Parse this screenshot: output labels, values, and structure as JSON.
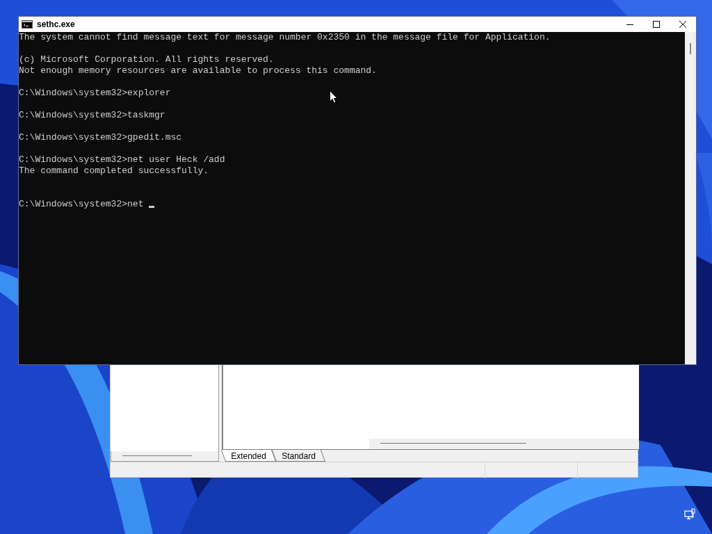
{
  "console": {
    "title": "sethc.exe",
    "lines": [
      {
        "kind": "output",
        "text": "The system cannot find message text for message number 0x2350 in the message file for Application."
      },
      {
        "kind": "blank"
      },
      {
        "kind": "output",
        "text": "(c) Microsoft Corporation. All rights reserved."
      },
      {
        "kind": "output",
        "text": "Not enough memory resources are available to process this command."
      },
      {
        "kind": "blank"
      },
      {
        "kind": "output",
        "text": "C:\\Windows\\system32>explorer"
      },
      {
        "kind": "blank"
      },
      {
        "kind": "output",
        "text": "C:\\Windows\\system32>taskmgr"
      },
      {
        "kind": "blank"
      },
      {
        "kind": "output",
        "text": "C:\\Windows\\system32>gpedit.msc"
      },
      {
        "kind": "blank"
      },
      {
        "kind": "output",
        "text": "C:\\Windows\\system32>net user Heck /add"
      },
      {
        "kind": "output",
        "text": "The command completed successfully."
      },
      {
        "kind": "blank"
      },
      {
        "kind": "blank"
      },
      {
        "kind": "prompt",
        "text": "C:\\Windows\\system32>net ",
        "cursor": true
      }
    ]
  },
  "back_window": {
    "tabs": [
      {
        "label": "Extended",
        "selected": true
      },
      {
        "label": "Standard",
        "selected": false
      }
    ]
  }
}
